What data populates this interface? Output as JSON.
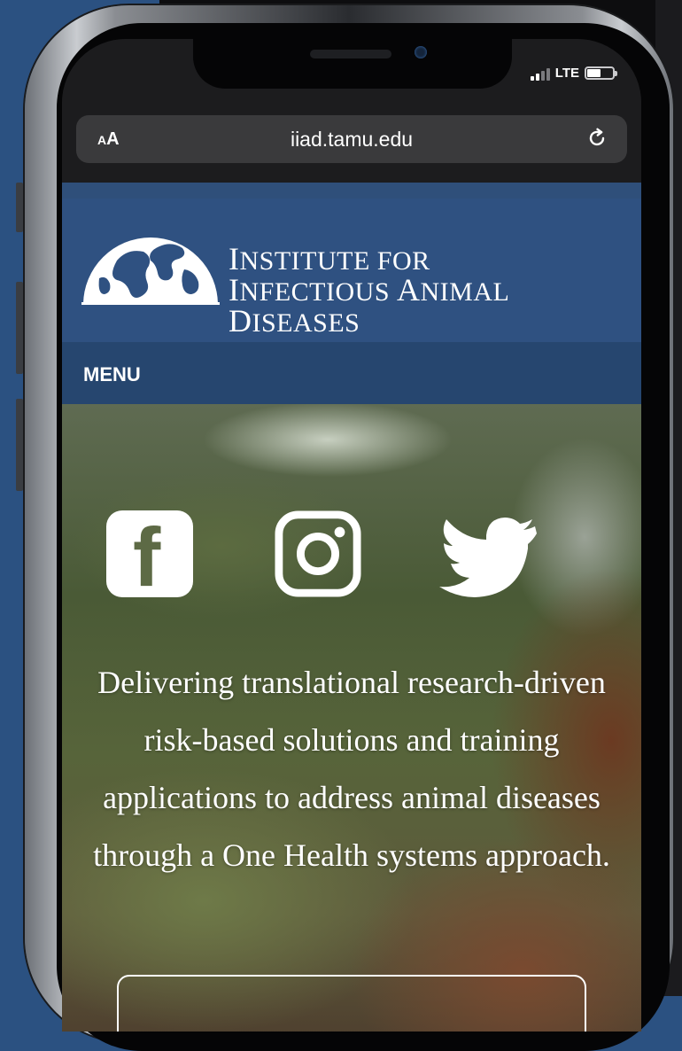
{
  "status_bar": {
    "network": "LTE",
    "battery_percent": 55
  },
  "browser": {
    "text_size_label_small": "A",
    "text_size_label_large": "A",
    "url": "iiad.tamu.edu"
  },
  "site": {
    "logo": {
      "line1_cap": "I",
      "line1_rest": "NSTITUTE FOR",
      "line2_cap1": "I",
      "line2_rest1": "NFECTIOUS ",
      "line2_cap2": "A",
      "line2_rest2": "NIMAL ",
      "line2_cap3": "D",
      "line2_rest3": "ISEASES"
    },
    "menu_label": "MENU",
    "social_icons": [
      "facebook-icon",
      "instagram-icon",
      "twitter-icon"
    ],
    "tagline": "Delivering translational research-driven risk-based solutions and training applications to address animal diseases through a One Health systems approach."
  },
  "colors": {
    "header_blue": "#2f5181",
    "menu_blue": "#26466f",
    "background_blue": "#2b5181"
  }
}
